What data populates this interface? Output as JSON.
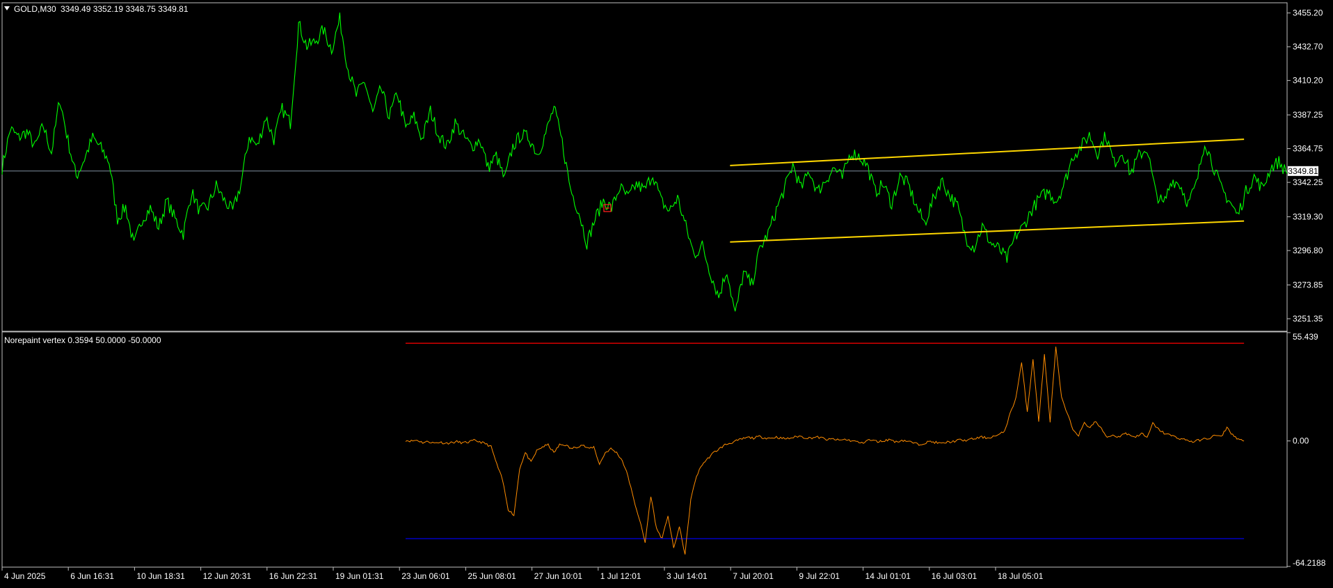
{
  "window": {
    "symbol": "GOLD,M30",
    "ohlc": "3349.49 3352.19 3348.75 3349.81",
    "indicator_label": "Norepaint vertex 0.3594 50.0000 -50.0000"
  },
  "colors": {
    "background": "#000000",
    "price_line": "#00ff00",
    "channel_line": "#ffd700",
    "indicator_line": "#ff8c00",
    "upper_level": "#ff0000",
    "lower_level": "#0000ff",
    "current_price_line": "#8090a0",
    "frame": "#c0c0c0"
  },
  "chart_data": [
    {
      "type": "line",
      "name": "price",
      "title": "GOLD,M30",
      "ylim": [
        3243,
        3462
      ],
      "y_ticks": [
        "3455.20",
        "3432.70",
        "3410.20",
        "3387.25",
        "3364.75",
        "3342.25",
        "3319.30",
        "3296.80",
        "3273.85",
        "3251.35"
      ],
      "x_ticks": [
        "4 Jun 2025",
        "6 Jun 16:31",
        "10 Jun 18:31",
        "12 Jun 20:31",
        "16 Jun 22:31",
        "19 Jun 01:31",
        "23 Jun 06:01",
        "25 Jun 08:01",
        "27 Jun 10:01",
        "1 Jul 12:01",
        "3 Jul 14:01",
        "7 Jul 20:01",
        "9 Jul 22:01",
        "14 Jul 01:01",
        "16 Jul 03:01",
        "18 Jul 05:01"
      ],
      "current_price": "3349.81",
      "current_price_value": 3349.81,
      "grid": false,
      "series": [
        {
          "values": [
            3352,
            3378,
            3372,
            3376,
            3366,
            3380,
            3362,
            3398,
            3370,
            3346,
            3358,
            3372,
            3365,
            3356,
            3318,
            3326,
            3300,
            3318,
            3325,
            3312,
            3330,
            3318,
            3308,
            3336,
            3323,
            3326,
            3340,
            3330,
            3323,
            3341,
            3373,
            3366,
            3386,
            3371,
            3391,
            3382,
            3448,
            3433,
            3436,
            3444,
            3431,
            3451,
            3418,
            3400,
            3410,
            3388,
            3405,
            3386,
            3402,
            3378,
            3386,
            3371,
            3390,
            3374,
            3366,
            3382,
            3373,
            3366,
            3371,
            3352,
            3360,
            3344,
            3366,
            3374,
            3372,
            3361,
            3375,
            3392,
            3369,
            3338,
            3323,
            3302,
            3318,
            3330,
            3325,
            3339,
            3332,
            3341,
            3337,
            3348,
            3330,
            3323,
            3332,
            3313,
            3294,
            3300,
            3282,
            3266,
            3284,
            3254,
            3282,
            3274,
            3298,
            3308,
            3324,
            3338,
            3354,
            3338,
            3350,
            3336,
            3344,
            3352,
            3345,
            3362,
            3360,
            3354,
            3336,
            3341,
            3328,
            3346,
            3341,
            3326,
            3315,
            3330,
            3344,
            3334,
            3326,
            3305,
            3299,
            3313,
            3302,
            3298,
            3291,
            3306,
            3313,
            3324,
            3332,
            3336,
            3330,
            3342,
            3360,
            3366,
            3374,
            3362,
            3374,
            3355,
            3363,
            3348,
            3360,
            3365,
            3336,
            3327,
            3344,
            3341,
            3328,
            3341,
            3370,
            3354,
            3338,
            3330,
            3320,
            3336,
            3346,
            3338,
            3352,
            3356,
            3348
          ]
        },
        {
          "name": "channel-upper",
          "points": [
            [
              0.5665,
              3353.5
            ],
            [
              0.9665,
              3371.0
            ]
          ]
        },
        {
          "name": "channel-lower",
          "points": [
            [
              0.5665,
              3302.5
            ],
            [
              0.9665,
              3316.5
            ]
          ]
        }
      ]
    },
    {
      "type": "line",
      "name": "indicator",
      "title": "Norepaint vertex",
      "ylim": [
        -64.2188,
        55.439
      ],
      "y_ticks": [
        "55.439",
        "0.00",
        "-64.2188"
      ],
      "levels": [
        50.0,
        -50.0
      ],
      "grid": false,
      "series": [
        {
          "x_start": 0.314,
          "x_end": 0.9665,
          "values": [
            0.3,
            0.0,
            0.4,
            -0.8,
            -0.3,
            -1.1,
            -0.6,
            -1.2,
            -0.9,
            -0.4,
            -1.0,
            -0.6,
            0.2,
            -0.4,
            -1.4,
            -3.0,
            -12,
            -20,
            -35,
            -38,
            -14,
            -6,
            -11,
            -5,
            -3,
            -2,
            -6,
            -2,
            -2,
            -4,
            -3,
            -2,
            -4,
            -3,
            -12,
            -6,
            -4,
            -6,
            -10,
            -18,
            -30,
            -40,
            -52,
            -28,
            -45,
            -50,
            -38,
            -55,
            -44,
            -58,
            -30,
            -18,
            -12,
            -9,
            -6,
            -4,
            -2,
            -1,
            0,
            1,
            1.8,
            1.5,
            2.2,
            1.6,
            1.4,
            2.0,
            1.3,
            1.2,
            1.8,
            2.5,
            1.7,
            1.5,
            2.0,
            1.5,
            0.6,
            1.0,
            0.3,
            0.8,
            0.2,
            -0.3,
            -1.2,
            0.5,
            0.2,
            -0.4,
            0.2,
            0.8,
            -0.6,
            0.4,
            -0.1,
            -1.0,
            -1.8,
            -1.0,
            -0.3,
            -0.8,
            -1.4,
            -0.6,
            -0.3,
            0.5,
            0.2,
            0.8,
            1.3,
            2.0,
            1.5,
            2.3,
            3.0,
            5.0,
            14,
            22,
            40,
            15,
            42,
            10,
            44,
            10,
            48,
            22,
            14,
            6,
            3,
            9,
            7,
            10,
            6,
            2,
            3,
            2,
            4,
            3,
            2,
            4,
            1.5,
            9,
            6,
            4,
            3,
            2,
            1,
            0.5,
            -0.5,
            0.3,
            1.0,
            1.5,
            3.0,
            2.0,
            7.0,
            3.0,
            1.0,
            0.0
          ]
        }
      ]
    }
  ]
}
